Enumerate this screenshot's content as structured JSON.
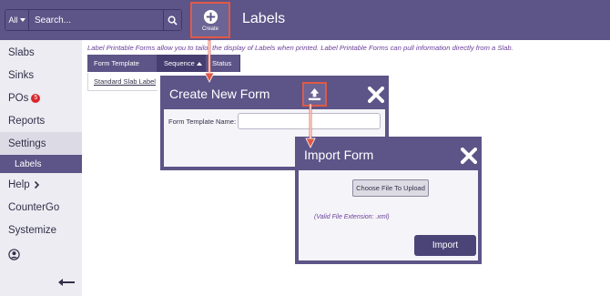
{
  "topbar": {
    "search_scope": "All",
    "search_placeholder": "Search...",
    "create_label": "Create",
    "page_title": "Labels"
  },
  "sidebar": {
    "items": [
      {
        "label": "Slabs"
      },
      {
        "label": "Sinks"
      },
      {
        "label": "POs",
        "badge": "5"
      },
      {
        "label": "Reports"
      },
      {
        "label": "Settings"
      },
      {
        "label": "Labels"
      },
      {
        "label": "Help"
      },
      {
        "label": "CounterGo"
      },
      {
        "label": "Systemize"
      }
    ]
  },
  "main": {
    "description": "Label Printable Forms allow you to tailor the display of Labels when printed. Label Printable Forms can pull information directly from a Slab.",
    "table": {
      "headers": [
        "Form Template",
        "Sequence",
        "Status"
      ],
      "rows": [
        [
          "Standard Slab Label"
        ]
      ]
    }
  },
  "create_modal": {
    "title": "Create New Form",
    "field_label": "Form Template Name:",
    "field_value": ""
  },
  "import_modal": {
    "title": "Import Form",
    "choose_label": "Choose File To Upload",
    "valid_ext": "(Valid File Extension: .xml)",
    "import_label": "Import"
  },
  "colors": {
    "brand": "#5d5487",
    "highlight": "#e05a46",
    "badge": "#d8262c"
  }
}
